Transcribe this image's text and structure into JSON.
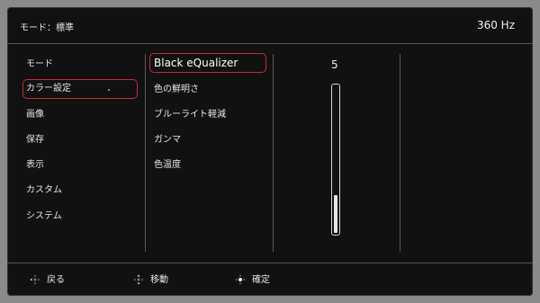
{
  "header": {
    "mode_text": "モード：標準",
    "refresh_rate": "360 Hz"
  },
  "left_menu": {
    "items": [
      {
        "label": "モード"
      },
      {
        "label": "カラー設定",
        "selected": true
      },
      {
        "label": "画像"
      },
      {
        "label": "保存"
      },
      {
        "label": "表示"
      },
      {
        "label": "カスタム"
      },
      {
        "label": "システム"
      }
    ]
  },
  "sub_menu": {
    "items": [
      {
        "label": "Black eQualizer",
        "selected": true
      },
      {
        "label": "色の鮮明さ"
      },
      {
        "label": "ブルーライト軽減"
      },
      {
        "label": "ガンマ"
      },
      {
        "label": "色温度"
      }
    ]
  },
  "setting": {
    "value": "5",
    "level_fraction": 0.25
  },
  "footer": {
    "back_label": "戻る",
    "move_label": "移動",
    "confirm_label": "確定",
    "icons": [
      "dpad-left-icon",
      "dpad-updown-icon",
      "dpad-center-icon"
    ]
  },
  "colors": {
    "accent": "#c8293a",
    "panel": "#111111"
  }
}
